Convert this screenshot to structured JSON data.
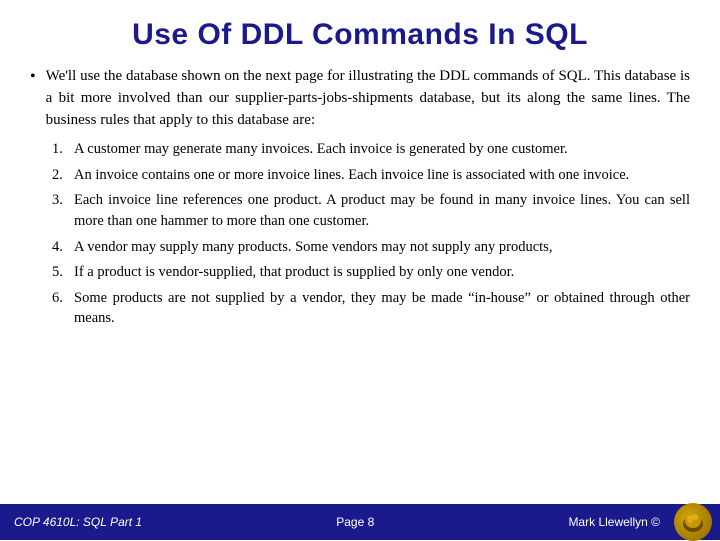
{
  "slide": {
    "title": "Use Of DDL Commands In SQL",
    "intro": "We'll use the database shown on the next page for illustrating the DDL commands of SQL.  This database is a bit more involved than our supplier-parts-jobs-shipments database, but its along the same lines.  The business rules that apply to this database are:",
    "bullet": "•",
    "items": [
      {
        "number": "1.",
        "text": "A customer may generate many invoices.  Each invoice is generated by one customer."
      },
      {
        "number": "2.",
        "text": "An invoice contains one or more invoice lines.  Each invoice line is associated with one invoice."
      },
      {
        "number": "3.",
        "text": "Each invoice line references one product.  A product may be found in many invoice lines.  You can sell more than one hammer to more than one customer."
      },
      {
        "number": "4.",
        "text": "A vendor may supply many products.  Some vendors may not supply any products,"
      },
      {
        "number": "5.",
        "text": "If a product is vendor-supplied, that product is supplied by only one vendor."
      },
      {
        "number": "6.",
        "text": "Some products are not supplied by a vendor, they may be made “in-house” or obtained through other means."
      }
    ],
    "footer": {
      "left": "COP 4610L: SQL Part 1",
      "center": "Page 8",
      "right": "Mark Llewellyn ©"
    }
  }
}
